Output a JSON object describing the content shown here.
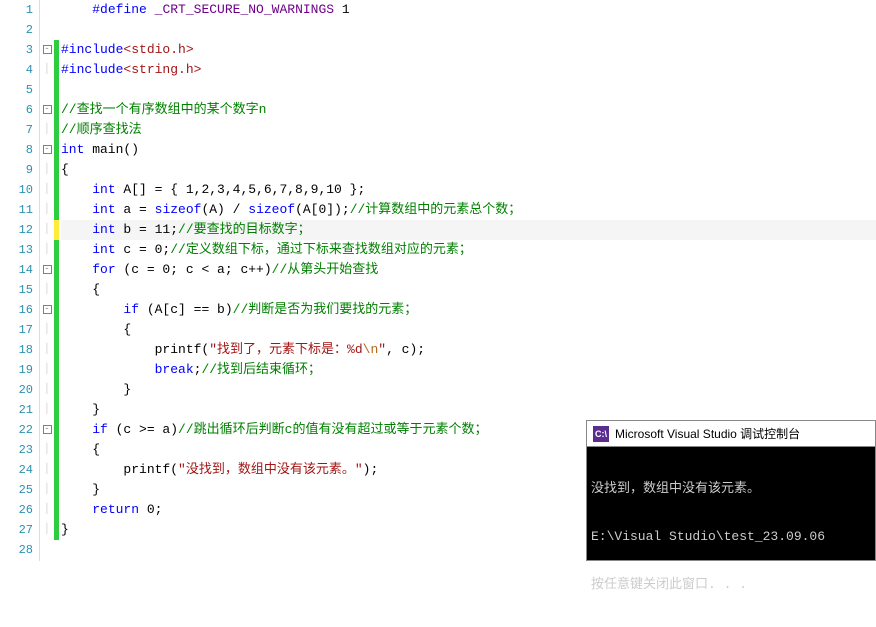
{
  "lines": [
    {
      "n": 1,
      "fold": "",
      "bar": "",
      "tokens": [
        {
          "t": "    ",
          "c": ""
        },
        {
          "t": "#define",
          "c": "kw"
        },
        {
          "t": " ",
          "c": ""
        },
        {
          "t": "_CRT_SECURE_NO_WARNINGS",
          "c": "mac"
        },
        {
          "t": " 1",
          "c": ""
        }
      ]
    },
    {
      "n": 2,
      "fold": "",
      "bar": "",
      "tokens": []
    },
    {
      "n": 3,
      "fold": "minus",
      "bar": "g",
      "tokens": [
        {
          "t": "#include",
          "c": "kw"
        },
        {
          "t": "<stdio.h>",
          "c": "inc"
        }
      ]
    },
    {
      "n": 4,
      "fold": "pipe",
      "bar": "g",
      "tokens": [
        {
          "t": "#include",
          "c": "kw"
        },
        {
          "t": "<string.h>",
          "c": "inc"
        }
      ]
    },
    {
      "n": 5,
      "fold": "",
      "bar": "g",
      "tokens": []
    },
    {
      "n": 6,
      "fold": "minus",
      "bar": "g",
      "tokens": [
        {
          "t": "//查找一个有序数组中的某个数字n",
          "c": "cmt"
        }
      ]
    },
    {
      "n": 7,
      "fold": "pipe",
      "bar": "g",
      "tokens": [
        {
          "t": "//顺序查找法",
          "c": "cmt"
        }
      ]
    },
    {
      "n": 8,
      "fold": "minus",
      "bar": "g",
      "tokens": [
        {
          "t": "int",
          "c": "typ"
        },
        {
          "t": " main()",
          "c": ""
        }
      ]
    },
    {
      "n": 9,
      "fold": "pipe",
      "bar": "g",
      "tokens": [
        {
          "t": "{",
          "c": ""
        }
      ]
    },
    {
      "n": 10,
      "fold": "pipe",
      "bar": "g",
      "tokens": [
        {
          "t": "    ",
          "c": ""
        },
        {
          "t": "int",
          "c": "typ"
        },
        {
          "t": " A[] = { 1,2,3,4,5,6,7,8,9,10 };",
          "c": ""
        }
      ]
    },
    {
      "n": 11,
      "fold": "pipe",
      "bar": "g",
      "tokens": [
        {
          "t": "    ",
          "c": ""
        },
        {
          "t": "int",
          "c": "typ"
        },
        {
          "t": " a = ",
          "c": ""
        },
        {
          "t": "sizeof",
          "c": "kw"
        },
        {
          "t": "(A) / ",
          "c": ""
        },
        {
          "t": "sizeof",
          "c": "kw"
        },
        {
          "t": "(A[0]);",
          "c": ""
        },
        {
          "t": "//计算数组中的元素总个数；",
          "c": "cmt"
        }
      ]
    },
    {
      "n": 12,
      "fold": "pipe",
      "bar": "y",
      "cur": true,
      "tokens": [
        {
          "t": "    ",
          "c": ""
        },
        {
          "t": "int",
          "c": "typ"
        },
        {
          "t": " b = 11;",
          "c": ""
        },
        {
          "t": "//要查找的目标数字；",
          "c": "cmt"
        }
      ]
    },
    {
      "n": 13,
      "fold": "pipe",
      "bar": "g",
      "tokens": [
        {
          "t": "    ",
          "c": ""
        },
        {
          "t": "int",
          "c": "typ"
        },
        {
          "t": " c = 0;",
          "c": ""
        },
        {
          "t": "//定义数组下标，通过下标来查找数组对应的元素；",
          "c": "cmt"
        }
      ]
    },
    {
      "n": 14,
      "fold": "minus",
      "bar": "g",
      "tokens": [
        {
          "t": "    ",
          "c": ""
        },
        {
          "t": "for",
          "c": "kw"
        },
        {
          "t": " (c = 0; c < a; c++)",
          "c": ""
        },
        {
          "t": "//从第头开始查找",
          "c": "cmt"
        }
      ]
    },
    {
      "n": 15,
      "fold": "pipe",
      "bar": "g",
      "tokens": [
        {
          "t": "    {",
          "c": ""
        }
      ]
    },
    {
      "n": 16,
      "fold": "minus",
      "bar": "g",
      "tokens": [
        {
          "t": "        ",
          "c": ""
        },
        {
          "t": "if",
          "c": "kw"
        },
        {
          "t": " (A[c] == b)",
          "c": ""
        },
        {
          "t": "//判断是否为我们要找的元素；",
          "c": "cmt"
        }
      ]
    },
    {
      "n": 17,
      "fold": "pipe",
      "bar": "g",
      "tokens": [
        {
          "t": "        {",
          "c": ""
        }
      ]
    },
    {
      "n": 18,
      "fold": "pipe",
      "bar": "g",
      "tokens": [
        {
          "t": "            printf(",
          "c": ""
        },
        {
          "t": "\"找到了，元素下标是：%d",
          "c": "str"
        },
        {
          "t": "\\n",
          "c": "esc"
        },
        {
          "t": "\"",
          "c": "str"
        },
        {
          "t": ", c);",
          "c": ""
        }
      ]
    },
    {
      "n": 19,
      "fold": "pipe",
      "bar": "g",
      "tokens": [
        {
          "t": "            ",
          "c": ""
        },
        {
          "t": "break",
          "c": "kw"
        },
        {
          "t": ";",
          "c": ""
        },
        {
          "t": "//找到后结束循环；",
          "c": "cmt"
        }
      ]
    },
    {
      "n": 20,
      "fold": "pipe",
      "bar": "g",
      "tokens": [
        {
          "t": "        }",
          "c": ""
        }
      ]
    },
    {
      "n": 21,
      "fold": "pipe",
      "bar": "g",
      "tokens": [
        {
          "t": "    }",
          "c": ""
        }
      ]
    },
    {
      "n": 22,
      "fold": "minus",
      "bar": "g",
      "tokens": [
        {
          "t": "    ",
          "c": ""
        },
        {
          "t": "if",
          "c": "kw"
        },
        {
          "t": " (c >= a)",
          "c": ""
        },
        {
          "t": "//跳出循环后判断c的值有没有超过或等于元素个数；",
          "c": "cmt"
        }
      ]
    },
    {
      "n": 23,
      "fold": "pipe",
      "bar": "g",
      "tokens": [
        {
          "t": "    {",
          "c": ""
        }
      ]
    },
    {
      "n": 24,
      "fold": "pipe",
      "bar": "g",
      "tokens": [
        {
          "t": "        printf(",
          "c": ""
        },
        {
          "t": "\"没找到，数组中没有该元素。\"",
          "c": "str"
        },
        {
          "t": ");",
          "c": ""
        }
      ]
    },
    {
      "n": 25,
      "fold": "pipe",
      "bar": "g",
      "tokens": [
        {
          "t": "    }",
          "c": ""
        }
      ]
    },
    {
      "n": 26,
      "fold": "pipe",
      "bar": "g",
      "tokens": [
        {
          "t": "    ",
          "c": ""
        },
        {
          "t": "return",
          "c": "kw"
        },
        {
          "t": " 0;",
          "c": ""
        }
      ]
    },
    {
      "n": 27,
      "fold": "pipe",
      "bar": "g",
      "tokens": [
        {
          "t": "}",
          "c": ""
        }
      ]
    },
    {
      "n": 28,
      "fold": "",
      "bar": "",
      "tokens": []
    }
  ],
  "console": {
    "icon": "C:\\",
    "title": "Microsoft Visual Studio 调试控制台",
    "out1": "没找到，数组中没有该元素。",
    "out2": "E:\\Visual Studio\\test_23.09.06",
    "out3": "按任意键关闭此窗口. . ."
  }
}
